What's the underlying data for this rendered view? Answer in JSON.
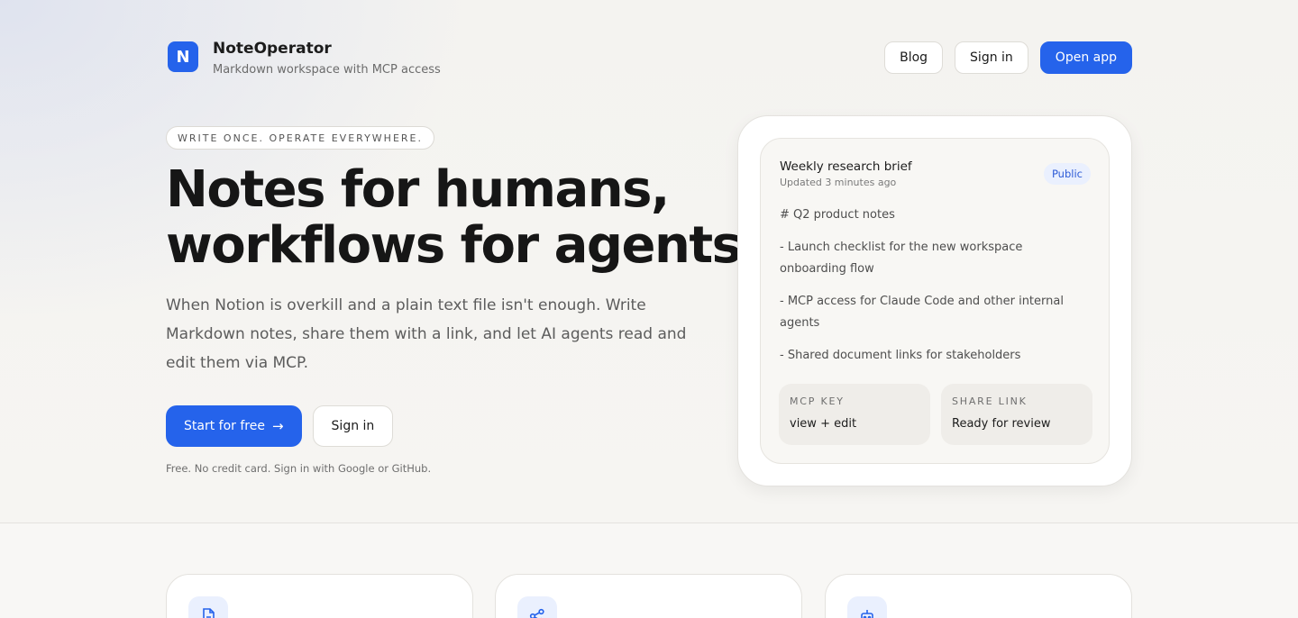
{
  "brand": {
    "logo_letter": "N",
    "title": "NoteOperator",
    "subtitle": "Markdown workspace with MCP access",
    "accent_color": "#2563eb"
  },
  "nav": {
    "blog": "Blog",
    "sign_in": "Sign in",
    "open_app": "Open app"
  },
  "hero": {
    "eyebrow": "WRITE ONCE. OPERATE EVERYWHERE.",
    "headline_line1": "Notes for humans,",
    "headline_line2": "workflows for agents.",
    "lede": "When Notion is overkill and a plain text file isn't enough. Write Markdown notes, share them with a link, and let AI agents read and edit them via MCP.",
    "cta_primary": "Start for free",
    "cta_secondary": "Sign in",
    "fine_print": "Free. No credit card. Sign in with Google or GitHub."
  },
  "preview": {
    "doc_title": "Weekly research brief",
    "updated": "Updated 3 minutes ago",
    "badge": "Public",
    "lines": [
      "# Q2 product notes",
      "- Launch checklist for the new workspace onboarding flow",
      "- MCP access for Claude Code and other internal agents",
      "- Shared document links for stakeholders"
    ],
    "meta": [
      {
        "label": "MCP KEY",
        "value": "view + edit"
      },
      {
        "label": "SHARE LINK",
        "value": "Ready for review"
      }
    ]
  },
  "features": [
    {
      "icon": "document-icon"
    },
    {
      "icon": "share-icon"
    },
    {
      "icon": "robot-icon"
    }
  ]
}
